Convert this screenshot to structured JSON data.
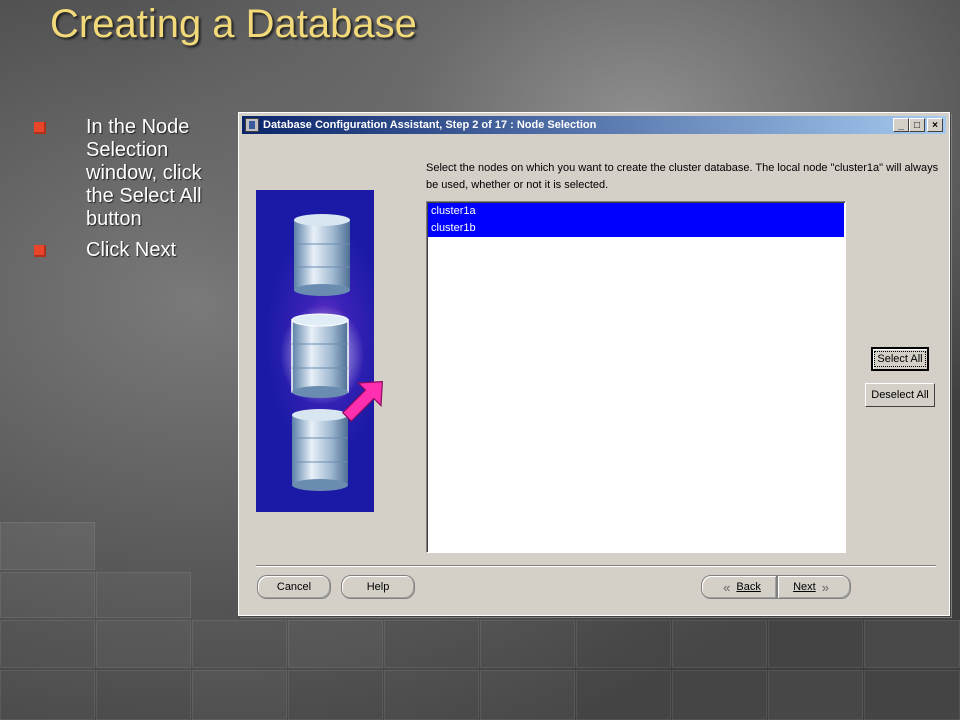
{
  "slide": {
    "title": "Creating a Database",
    "bullets": [
      "In the Node Selection window, click the Select All button",
      "Click Next"
    ]
  },
  "dialog": {
    "title": "Database Configuration Assistant, Step 2 of 17 : Node Selection",
    "window_buttons": {
      "minimize": "_",
      "maximize": "□",
      "close": "×"
    },
    "instructions": "Select the nodes on which you want to create the cluster database. The local node \"cluster1a\" will always be used, whether or not it is selected.",
    "nodes": [
      {
        "name": "cluster1a",
        "selected": true
      },
      {
        "name": "cluster1b",
        "selected": true
      }
    ],
    "select_all_label": "Select All",
    "deselect_all_label": "Deselect All",
    "cancel_label": "Cancel",
    "help_label": "Help",
    "back_label": "Back",
    "next_label": "Next",
    "selection_color": "#0000ff"
  },
  "colors": {
    "title": "#f2d97a",
    "bullet": "#e8452b",
    "titlebar_start": "#0a246a",
    "titlebar_end": "#a6caf0",
    "arrow": "#ff2fb0"
  }
}
